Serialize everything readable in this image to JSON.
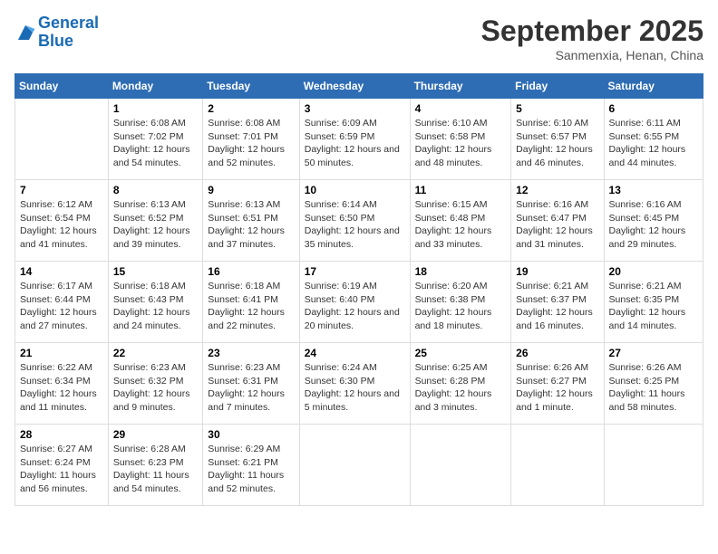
{
  "logo": {
    "line1": "General",
    "line2": "Blue"
  },
  "title": "September 2025",
  "subtitle": "Sanmenxia, Henan, China",
  "days_of_week": [
    "Sunday",
    "Monday",
    "Tuesday",
    "Wednesday",
    "Thursday",
    "Friday",
    "Saturday"
  ],
  "weeks": [
    [
      {
        "day": "",
        "info": ""
      },
      {
        "day": "1",
        "info": "Sunrise: 6:08 AM\nSunset: 7:02 PM\nDaylight: 12 hours and 54 minutes."
      },
      {
        "day": "2",
        "info": "Sunrise: 6:08 AM\nSunset: 7:01 PM\nDaylight: 12 hours and 52 minutes."
      },
      {
        "day": "3",
        "info": "Sunrise: 6:09 AM\nSunset: 6:59 PM\nDaylight: 12 hours and 50 minutes."
      },
      {
        "day": "4",
        "info": "Sunrise: 6:10 AM\nSunset: 6:58 PM\nDaylight: 12 hours and 48 minutes."
      },
      {
        "day": "5",
        "info": "Sunrise: 6:10 AM\nSunset: 6:57 PM\nDaylight: 12 hours and 46 minutes."
      },
      {
        "day": "6",
        "info": "Sunrise: 6:11 AM\nSunset: 6:55 PM\nDaylight: 12 hours and 44 minutes."
      }
    ],
    [
      {
        "day": "7",
        "info": "Sunrise: 6:12 AM\nSunset: 6:54 PM\nDaylight: 12 hours and 41 minutes."
      },
      {
        "day": "8",
        "info": "Sunrise: 6:13 AM\nSunset: 6:52 PM\nDaylight: 12 hours and 39 minutes."
      },
      {
        "day": "9",
        "info": "Sunrise: 6:13 AM\nSunset: 6:51 PM\nDaylight: 12 hours and 37 minutes."
      },
      {
        "day": "10",
        "info": "Sunrise: 6:14 AM\nSunset: 6:50 PM\nDaylight: 12 hours and 35 minutes."
      },
      {
        "day": "11",
        "info": "Sunrise: 6:15 AM\nSunset: 6:48 PM\nDaylight: 12 hours and 33 minutes."
      },
      {
        "day": "12",
        "info": "Sunrise: 6:16 AM\nSunset: 6:47 PM\nDaylight: 12 hours and 31 minutes."
      },
      {
        "day": "13",
        "info": "Sunrise: 6:16 AM\nSunset: 6:45 PM\nDaylight: 12 hours and 29 minutes."
      }
    ],
    [
      {
        "day": "14",
        "info": "Sunrise: 6:17 AM\nSunset: 6:44 PM\nDaylight: 12 hours and 27 minutes."
      },
      {
        "day": "15",
        "info": "Sunrise: 6:18 AM\nSunset: 6:43 PM\nDaylight: 12 hours and 24 minutes."
      },
      {
        "day": "16",
        "info": "Sunrise: 6:18 AM\nSunset: 6:41 PM\nDaylight: 12 hours and 22 minutes."
      },
      {
        "day": "17",
        "info": "Sunrise: 6:19 AM\nSunset: 6:40 PM\nDaylight: 12 hours and 20 minutes."
      },
      {
        "day": "18",
        "info": "Sunrise: 6:20 AM\nSunset: 6:38 PM\nDaylight: 12 hours and 18 minutes."
      },
      {
        "day": "19",
        "info": "Sunrise: 6:21 AM\nSunset: 6:37 PM\nDaylight: 12 hours and 16 minutes."
      },
      {
        "day": "20",
        "info": "Sunrise: 6:21 AM\nSunset: 6:35 PM\nDaylight: 12 hours and 14 minutes."
      }
    ],
    [
      {
        "day": "21",
        "info": "Sunrise: 6:22 AM\nSunset: 6:34 PM\nDaylight: 12 hours and 11 minutes."
      },
      {
        "day": "22",
        "info": "Sunrise: 6:23 AM\nSunset: 6:32 PM\nDaylight: 12 hours and 9 minutes."
      },
      {
        "day": "23",
        "info": "Sunrise: 6:23 AM\nSunset: 6:31 PM\nDaylight: 12 hours and 7 minutes."
      },
      {
        "day": "24",
        "info": "Sunrise: 6:24 AM\nSunset: 6:30 PM\nDaylight: 12 hours and 5 minutes."
      },
      {
        "day": "25",
        "info": "Sunrise: 6:25 AM\nSunset: 6:28 PM\nDaylight: 12 hours and 3 minutes."
      },
      {
        "day": "26",
        "info": "Sunrise: 6:26 AM\nSunset: 6:27 PM\nDaylight: 12 hours and 1 minute."
      },
      {
        "day": "27",
        "info": "Sunrise: 6:26 AM\nSunset: 6:25 PM\nDaylight: 11 hours and 58 minutes."
      }
    ],
    [
      {
        "day": "28",
        "info": "Sunrise: 6:27 AM\nSunset: 6:24 PM\nDaylight: 11 hours and 56 minutes."
      },
      {
        "day": "29",
        "info": "Sunrise: 6:28 AM\nSunset: 6:23 PM\nDaylight: 11 hours and 54 minutes."
      },
      {
        "day": "30",
        "info": "Sunrise: 6:29 AM\nSunset: 6:21 PM\nDaylight: 11 hours and 52 minutes."
      },
      {
        "day": "",
        "info": ""
      },
      {
        "day": "",
        "info": ""
      },
      {
        "day": "",
        "info": ""
      },
      {
        "day": "",
        "info": ""
      }
    ]
  ]
}
